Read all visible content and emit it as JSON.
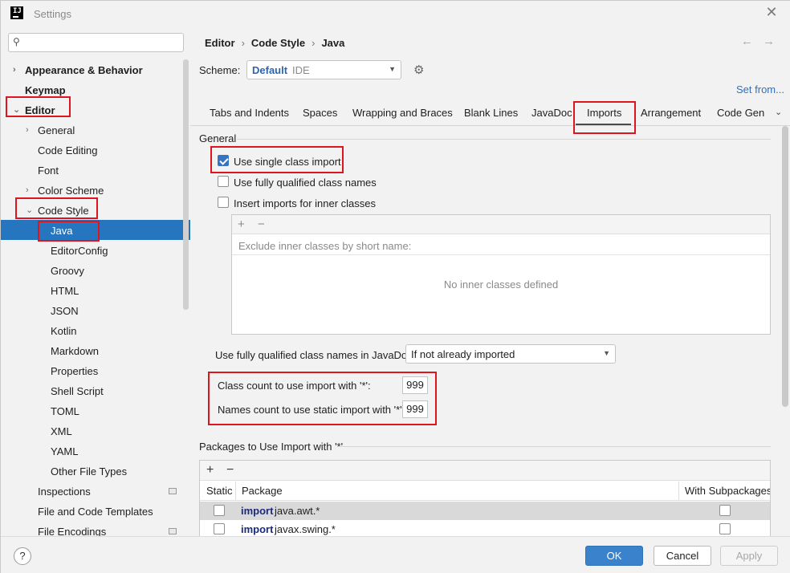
{
  "window": {
    "title": "Settings"
  },
  "sidebar": {
    "search_placeholder": "",
    "items": [
      {
        "label": "Appearance & Behavior",
        "level": 0,
        "bold": true,
        "expander": "collapsed"
      },
      {
        "label": "Keymap",
        "level": 0,
        "bold": true,
        "expander": "none"
      },
      {
        "label": "Editor",
        "level": 0,
        "bold": true,
        "expander": "expanded"
      },
      {
        "label": "General",
        "level": 1,
        "expander": "collapsed"
      },
      {
        "label": "Code Editing",
        "level": 1,
        "expander": "none"
      },
      {
        "label": "Font",
        "level": 1,
        "expander": "none"
      },
      {
        "label": "Color Scheme",
        "level": 1,
        "expander": "collapsed"
      },
      {
        "label": "Code Style",
        "level": 1,
        "expander": "expanded"
      },
      {
        "label": "Java",
        "level": 2,
        "selected": true
      },
      {
        "label": "EditorConfig",
        "level": 2
      },
      {
        "label": "Groovy",
        "level": 2
      },
      {
        "label": "HTML",
        "level": 2
      },
      {
        "label": "JSON",
        "level": 2
      },
      {
        "label": "Kotlin",
        "level": 2
      },
      {
        "label": "Markdown",
        "level": 2
      },
      {
        "label": "Properties",
        "level": 2
      },
      {
        "label": "Shell Script",
        "level": 2
      },
      {
        "label": "TOML",
        "level": 2
      },
      {
        "label": "XML",
        "level": 2
      },
      {
        "label": "YAML",
        "level": 2
      },
      {
        "label": "Other File Types",
        "level": 2
      },
      {
        "label": "Inspections",
        "level": 1
      },
      {
        "label": "File and Code Templates",
        "level": 1
      },
      {
        "label": "File Encodings",
        "level": 1
      }
    ]
  },
  "breadcrumb": {
    "part1": "Editor",
    "part2": "Code Style",
    "part3": "Java",
    "separator": "›"
  },
  "nav": {
    "back": "←",
    "forward": "→"
  },
  "scheme": {
    "label": "Scheme:",
    "value": "Default",
    "sub": "IDE",
    "set_from": "Set from..."
  },
  "tabs": [
    "Tabs and Indents",
    "Spaces",
    "Wrapping and Braces",
    "Blank Lines",
    "JavaDoc",
    "Imports",
    "Arrangement",
    "Code Gen"
  ],
  "active_tab": "Imports",
  "general": {
    "title": "General",
    "use_single_class_import": {
      "label": "Use single class import",
      "checked": true
    },
    "use_fully_qualified": {
      "label": "Use fully qualified class names",
      "checked": false
    },
    "insert_inner_imports": {
      "label": "Insert imports for inner classes",
      "checked": false
    },
    "inner_toolbar_add": "+",
    "inner_toolbar_remove": "−",
    "inner_hint": "Exclude inner classes by short name:",
    "inner_empty": "No inner classes defined",
    "javadoc_label": "Use fully qualified class names in JavaDoc:",
    "javadoc_value": "If not already imported",
    "class_count_label": "Class count to use import with '*':",
    "class_count_value": "999",
    "names_count_label": "Names count to use static import with '*':",
    "names_count_value": "999"
  },
  "packages": {
    "title": "Packages to Use Import with '*'",
    "add": "+",
    "remove": "−",
    "columns": [
      "Static",
      "Package",
      "With Subpackages"
    ],
    "rows": [
      {
        "keyword": "import",
        "package": "java.awt.*",
        "static": false,
        "with_subpackages": false
      },
      {
        "keyword": "import",
        "package": "javax.swing.*",
        "static": false,
        "with_subpackages": false
      }
    ]
  },
  "buttons": {
    "help": "?",
    "ok": "OK",
    "cancel": "Cancel",
    "apply": "Apply"
  },
  "colors": {
    "accent": "#2675bf",
    "highlight": "#e0141c",
    "link": "#2e70c0"
  }
}
